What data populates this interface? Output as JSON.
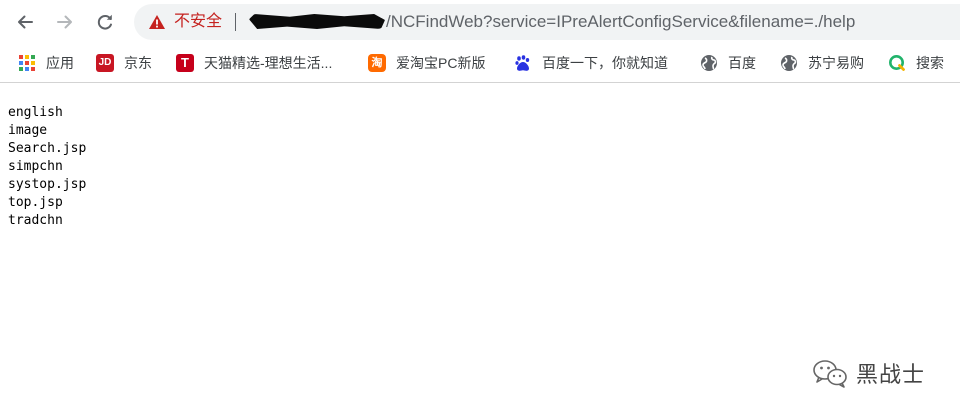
{
  "browser": {
    "security_label": "不安全",
    "url_path": "/NCFindWeb?service=IPreAlertConfigService&filename=./help"
  },
  "bookmarks": [
    {
      "label": "应用",
      "icon": "apps-grid-icon"
    },
    {
      "label": "京东",
      "icon": "jd-icon"
    },
    {
      "label": "天猫精选-理想生活...",
      "icon": "tmall-icon"
    },
    {
      "label": "爱淘宝PC新版",
      "icon": "taobao-icon"
    },
    {
      "label": "百度一下，你就知道",
      "icon": "baidu-paw-icon"
    },
    {
      "label": "百度",
      "icon": "globe-icon"
    },
    {
      "label": "苏宁易购",
      "icon": "globe-icon"
    },
    {
      "label": "搜索",
      "icon": "search-q-icon"
    }
  ],
  "icon_glyphs": {
    "jd": "JD",
    "tmall": "T",
    "taobao": "淘"
  },
  "page": {
    "lines": [
      "english",
      "image",
      "Search.jsp",
      "simpchn",
      "systop.jsp",
      "top.jsp",
      "tradchn"
    ]
  },
  "watermark": {
    "text": "黑战士"
  },
  "colors": {
    "insecure": "#c5221f",
    "omnibox_bg": "#f1f3f4",
    "url_text": "#5f6368"
  }
}
